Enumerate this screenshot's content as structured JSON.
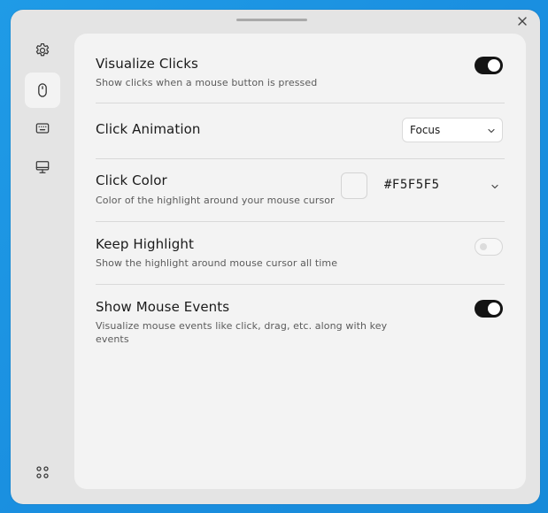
{
  "window": {
    "close_icon": "close-icon"
  },
  "sidebar": {
    "items": [
      {
        "name": "settings",
        "icon": "gear-icon",
        "active": false
      },
      {
        "name": "mouse",
        "icon": "mouse-icon",
        "active": true
      },
      {
        "name": "keyboard",
        "icon": "keyboard-icon",
        "active": false
      },
      {
        "name": "display",
        "icon": "monitor-icon",
        "active": false
      }
    ],
    "bottom_icon": "apps-grid-icon"
  },
  "settings": {
    "visualize_clicks": {
      "title": "Visualize Clicks",
      "description": "Show clicks when a mouse button is pressed",
      "enabled": true
    },
    "click_animation": {
      "title": "Click Animation",
      "selected": "Focus"
    },
    "click_color": {
      "title": "Click Color",
      "description": "Color of the highlight around your mouse cursor",
      "value": "#F5F5F5"
    },
    "keep_highlight": {
      "title": "Keep Highlight",
      "description": "Show the highlight around mouse cursor all time",
      "enabled": false
    },
    "show_mouse_events": {
      "title": "Show Mouse Events",
      "description": "Visualize mouse events like click, drag, etc. along with key events",
      "enabled": true
    }
  },
  "colors": {
    "desktop": "#1f9be6",
    "window": "#e4e4e4",
    "panel": "#f3f3f3",
    "toggle_on": "#141414",
    "swatch": "#F5F5F5"
  }
}
